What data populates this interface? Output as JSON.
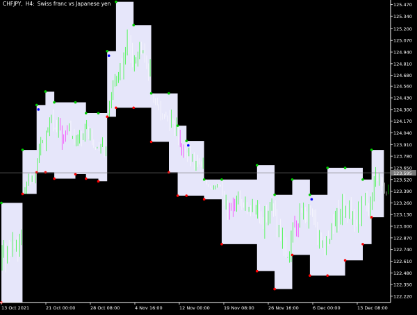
{
  "window": {
    "symbol": "CHFJPY,",
    "timeframe": "H4:",
    "description": "Swiss franc vs Japanese yen"
  },
  "colors": {
    "background": "#000000",
    "channel_fill": "#e6e6fa",
    "axis": "#ffffff",
    "candle_up": "#00ff00",
    "candle_down": "#ffffff",
    "candle_sell": "#ff00ff",
    "candle_buy": "#00ffff",
    "dot_high": "#00cc00",
    "dot_low": "#ff0000",
    "dot_signal": "#0000ff",
    "current_line": "#777777",
    "price_tag": "#777777"
  },
  "chart_data": {
    "type": "candlestick",
    "y_axis": {
      "min": 122.15,
      "max": 125.52,
      "ticks": [
        "125.470",
        "125.340",
        "125.200",
        "125.070",
        "124.940",
        "124.810",
        "124.680",
        "124.560",
        "124.430",
        "124.300",
        "124.170",
        "124.040",
        "123.910",
        "123.780",
        "123.650",
        "123.520",
        "123.390",
        "123.260",
        "123.130",
        "123.000",
        "122.870",
        "122.740",
        "122.610",
        "122.480",
        "122.350",
        "122.220"
      ],
      "current_price": 123.595,
      "current_price_label": "123.595"
    },
    "x_axis": {
      "labels": [
        "13 Oct 2021",
        "21 Oct 00:00",
        "28 Oct 08:00",
        "4 Nov 16:00",
        "12 Nov 00:00",
        "19 Nov 08:00",
        "26 Nov 16:00",
        "6 Dec 00:00",
        "13 Dec 08:00"
      ],
      "bars": 220
    },
    "channel": [
      {
        "from": 0,
        "to": 12,
        "upper": 123.26,
        "lower": 122.15
      },
      {
        "from": 12,
        "to": 20,
        "upper": 123.85,
        "lower": 123.36
      },
      {
        "from": 20,
        "to": 25,
        "upper": 124.35,
        "lower": 123.6
      },
      {
        "from": 25,
        "to": 30,
        "upper": 124.5,
        "lower": 123.6
      },
      {
        "from": 30,
        "to": 42,
        "upper": 124.38,
        "lower": 123.53
      },
      {
        "from": 42,
        "to": 48,
        "upper": 124.38,
        "lower": 123.58
      },
      {
        "from": 48,
        "to": 55,
        "upper": 124.26,
        "lower": 123.53
      },
      {
        "from": 55,
        "to": 60,
        "upper": 124.26,
        "lower": 123.5
      },
      {
        "from": 60,
        "to": 65,
        "upper": 124.95,
        "lower": 124.22
      },
      {
        "from": 65,
        "to": 75,
        "upper": 125.5,
        "lower": 124.32
      },
      {
        "from": 75,
        "to": 85,
        "upper": 125.24,
        "lower": 124.32
      },
      {
        "from": 85,
        "to": 95,
        "upper": 124.48,
        "lower": 123.94
      },
      {
        "from": 95,
        "to": 100,
        "upper": 124.48,
        "lower": 123.6
      },
      {
        "from": 100,
        "to": 105,
        "upper": 124.12,
        "lower": 123.34
      },
      {
        "from": 105,
        "to": 115,
        "upper": 123.95,
        "lower": 123.34
      },
      {
        "from": 115,
        "to": 125,
        "upper": 123.52,
        "lower": 123.3
      },
      {
        "from": 125,
        "to": 145,
        "upper": 123.52,
        "lower": 122.8
      },
      {
        "from": 145,
        "to": 155,
        "upper": 123.68,
        "lower": 122.5
      },
      {
        "from": 155,
        "to": 165,
        "upper": 123.35,
        "lower": 122.3
      },
      {
        "from": 165,
        "to": 175,
        "upper": 123.52,
        "lower": 122.68
      },
      {
        "from": 175,
        "to": 185,
        "upper": 123.35,
        "lower": 122.45
      },
      {
        "from": 185,
        "to": 195,
        "upper": 123.65,
        "lower": 122.45
      },
      {
        "from": 195,
        "to": 205,
        "upper": 123.65,
        "lower": 122.62
      },
      {
        "from": 205,
        "to": 210,
        "upper": 123.52,
        "lower": 122.8
      },
      {
        "from": 210,
        "to": 217,
        "upper": 123.85,
        "lower": 123.1
      }
    ],
    "candles_seed": 42
  }
}
